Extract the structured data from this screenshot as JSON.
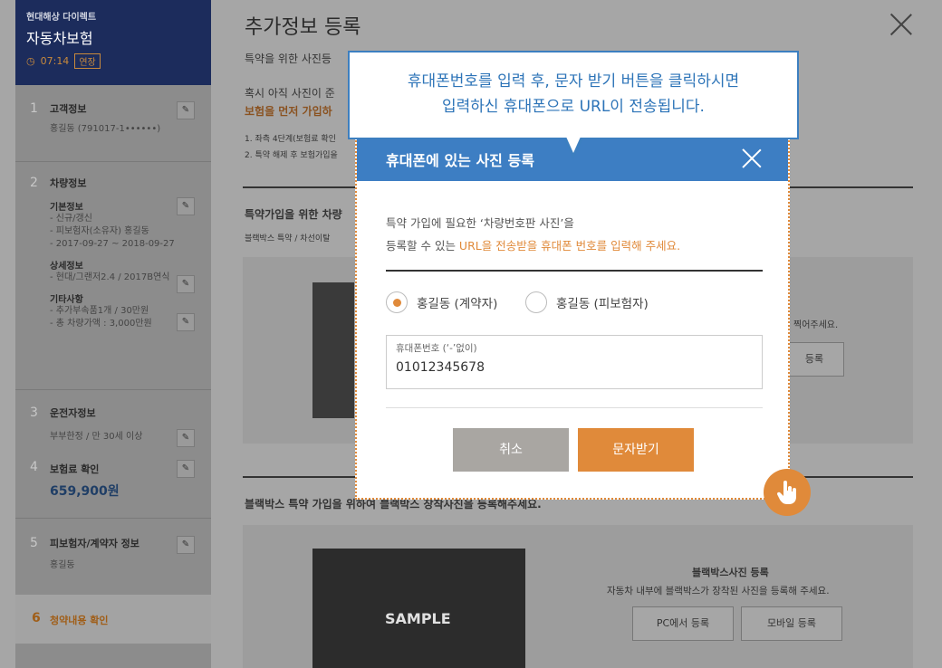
{
  "sidebar": {
    "company": "현대해상 다이렉트",
    "product": "자동차보험",
    "timer": "07:14",
    "extend_label": "연장",
    "steps": [
      {
        "num": "1",
        "title": "고객정보",
        "lines": [
          "홍길동 (791017-1••••••)"
        ]
      },
      {
        "num": "2",
        "title": "차량정보",
        "groups": [
          {
            "sub": "기본정보",
            "lines": [
              "- 신규/갱신",
              "- 피보험자(소유자) 홍길동",
              "- 2017-09-27 ~ 2018-09-27"
            ]
          },
          {
            "sub": "상세정보",
            "lines": [
              "- 현대/그랜저2.4 / 2017B연식"
            ]
          },
          {
            "sub": "기타사항",
            "lines": [
              "- 추가부속품1개 / 30만원",
              "- 총 차량가액 : 3,000만원"
            ]
          }
        ]
      },
      {
        "num": "3",
        "title": "운전자정보",
        "lines": [
          "부부한정 / 만 30세 이상"
        ]
      },
      {
        "num": "4",
        "title": "보험료 확인",
        "price": "659,900원"
      },
      {
        "num": "5",
        "title": "피보험자/계약자 정보",
        "lines": [
          "홍길동"
        ]
      },
      {
        "num": "6",
        "title": "청약내용 확인"
      }
    ]
  },
  "main": {
    "title": "추가정보 등록",
    "intro": "특약을 위한 사진등",
    "notice1": "혹시 아직 사진이 준",
    "notice2": "보험을 먼저 가입하",
    "small1": "1. 좌측 4단계(보험료 확인",
    "small2": "2. 특약 해제 후 보험가입을",
    "section1_title": "특약가입을 위한 차량",
    "section1_sub": "블랙박스 특약 / 차선이탈",
    "section1_tail": "찍어주세요.",
    "section1_button": "등록",
    "section2_title": "블랙박스 특약 가입을 위하여 블랙박스 장착사진을 등록해주세요.",
    "blackbox_title": "블랙박스사진 등록",
    "blackbox_desc": "자동차 내부에 블랙박스가 장착된 사진을 등록해 주세요.",
    "pc_button": "PC에서 등록",
    "mobile_button": "모바일 등록",
    "sample_label": "SAMPLE"
  },
  "tooltip": {
    "line1": "휴대폰번호를 입력 후, 문자 받기 버튼을 클릭하시면",
    "line2": "입력하신 휴대폰으로 URL이 전송됩니다."
  },
  "modal": {
    "title": "휴대폰에 있는 사진 등록",
    "desc_line1": "특약 가입에 필요한 ‘차량번호판 사진’을",
    "desc_line2_plain": "등록할 수 있는 ",
    "desc_line2_highlight": "URL을 전송받을 휴대폰 번호를 입력해 주세요.",
    "radio1": "홍길동 (계약자)",
    "radio2": "홍길동 (피보험자)",
    "phone_label": "휴대폰번호 (‘-’없이)",
    "phone_value": "01012345678",
    "cancel": "취소",
    "send": "문자받기"
  },
  "colors": {
    "accent": "#e08a3a",
    "header_blue": "#3d7ec3",
    "navy": "#1c2c5c"
  }
}
